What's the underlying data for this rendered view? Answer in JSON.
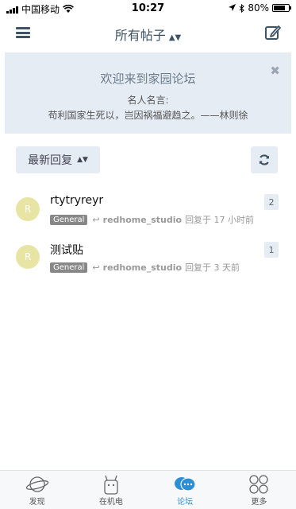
{
  "status_bar": {
    "carrier": "中国移动",
    "time": "10:27",
    "battery": "80%",
    "battery_level": 0.8
  },
  "nav": {
    "title": "所有帖子",
    "menu_icon": "hamburger-icon",
    "compose_icon": "compose-icon"
  },
  "banner": {
    "title": "欢迎来到家园论坛",
    "subtitle": "名人名言:",
    "quote": "苟利国家生死以，岂因祸福避趋之。——林则徐",
    "close_icon": "close-icon"
  },
  "filter": {
    "sort_label": "最新回复",
    "refresh_icon": "refresh-icon"
  },
  "topics": [
    {
      "avatar": "R",
      "title": "rtytryreyr",
      "tag": "General",
      "author": "redhome_studio",
      "time": "回复于 17 小时前",
      "count": "2"
    },
    {
      "avatar": "R",
      "title": "测试贴",
      "tag": "General",
      "author": "redhome_studio",
      "time": "回复于 3 天前",
      "count": "1"
    }
  ],
  "tabs": [
    {
      "label": "发现",
      "icon": "planet-icon"
    },
    {
      "label": "在机电",
      "icon": "robot-icon"
    },
    {
      "label": "论坛",
      "icon": "chat-bubbles-icon"
    },
    {
      "label": "更多",
      "icon": "grid-circles-icon"
    }
  ],
  "colors": {
    "accent": "#2b8fd6",
    "banner_bg": "#e6ecf4",
    "nav_text": "#3e5466",
    "avatar_bg": "#e8e5a4"
  }
}
